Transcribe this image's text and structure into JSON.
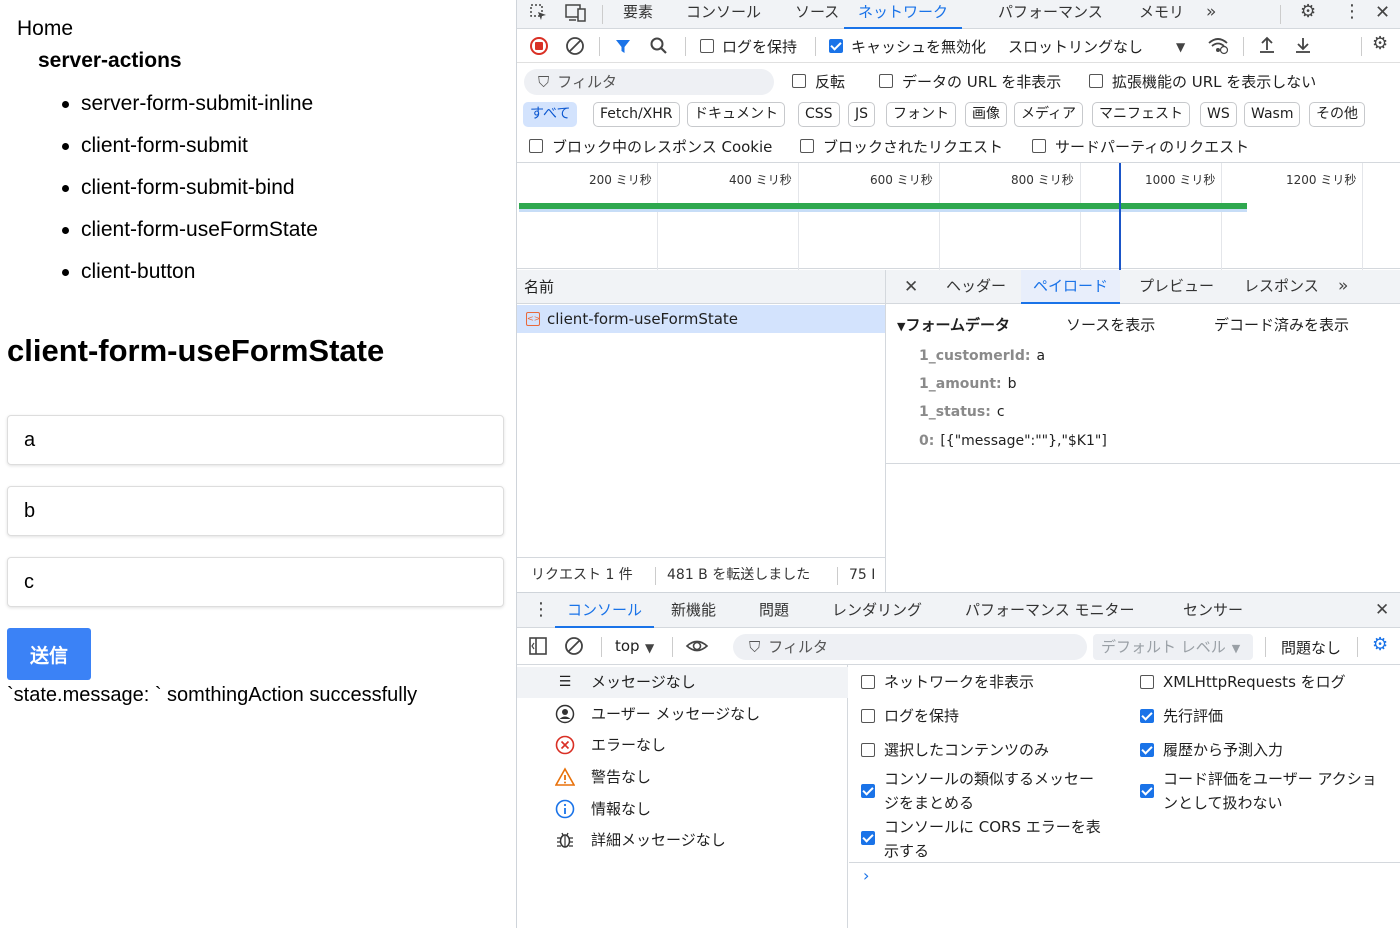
{
  "page": {
    "home_link": "Home",
    "section_title": "server-actions",
    "nav_items": [
      "server-form-submit-inline",
      "client-form-submit",
      "client-form-submit-bind",
      "client-form-useFormState",
      "client-button"
    ],
    "form_title": "client-form-useFormState",
    "fields": [
      {
        "value": "a"
      },
      {
        "value": "b"
      },
      {
        "value": "c"
      }
    ],
    "submit_label": "送信",
    "state_message": "`state.message: ` somthingAction successfully"
  },
  "devtools": {
    "main_tabs": [
      "要素",
      "コンソール",
      "ソース",
      "ネットワーク",
      "パフォーマンス",
      "メモリ"
    ],
    "active_main_tab": "ネットワーク",
    "network_toolbar": {
      "preserve_log_label": "ログを保持",
      "preserve_log_checked": false,
      "disable_cache_label": "キャッシュを無効化",
      "disable_cache_checked": true,
      "throttling_label": "スロットリングなし"
    },
    "filter_bar": {
      "placeholder": "フィルタ",
      "invert_label": "反転",
      "hide_data_url_label": "データの URL を非表示",
      "hide_ext_url_label": "拡張機能の URL を表示しない"
    },
    "type_chips": [
      "すべて",
      "Fetch/XHR",
      "ドキュメント",
      "CSS",
      "JS",
      "フォント",
      "画像",
      "メディア",
      "マニフェスト",
      "WS",
      "Wasm",
      "その他"
    ],
    "active_chip": "すべて",
    "blocked_options": {
      "blocked_cookies_label": "ブロック中のレスポンス Cookie",
      "blocked_requests_label": "ブロックされたリクエスト",
      "third_party_label": "サードパーティのリクエスト"
    },
    "timeline_ticks": [
      "200 ミリ秒",
      "400 ミリ秒",
      "600 ミリ秒",
      "800 ミリ秒",
      "1000 ミリ秒",
      "1200 ミリ秒"
    ],
    "request_list": {
      "name_header": "名前",
      "requests": [
        {
          "name": "client-form-useFormState"
        }
      ],
      "status_requests": "リクエスト 1 件",
      "status_transferred": "481 B を転送しました",
      "status_resources": "75 I"
    },
    "detail_tabs": [
      "ヘッダー",
      "ペイロード",
      "プレビュー",
      "レスポンス"
    ],
    "active_detail_tab": "ペイロード",
    "payload": {
      "section_label": "フォームデータ",
      "view_source_label": "ソースを表示",
      "view_decoded_label": "デコード済みを表示",
      "entries": [
        {
          "key": "1_customerId:",
          "value": "a"
        },
        {
          "key": "1_amount:",
          "value": "b"
        },
        {
          "key": "1_status:",
          "value": "c"
        },
        {
          "key": "0:",
          "value": "[{\"message\":\"\"},\"$K1\"]"
        }
      ]
    },
    "drawer_tabs": [
      "コンソール",
      "新機能",
      "問題",
      "レンダリング",
      "パフォーマンス モニター",
      "センサー"
    ],
    "active_drawer_tab": "コンソール",
    "console_toolbar": {
      "context": "top",
      "filter_placeholder": "フィルタ",
      "level": "デフォルト レベル",
      "issues": "問題なし"
    },
    "console_sidebar": [
      {
        "label": "メッセージなし",
        "icon": "list-icon"
      },
      {
        "label": "ユーザー メッセージなし",
        "icon": "user-icon"
      },
      {
        "label": "エラーなし",
        "icon": "error-icon"
      },
      {
        "label": "警告なし",
        "icon": "warning-icon"
      },
      {
        "label": "情報なし",
        "icon": "info-icon"
      },
      {
        "label": "詳細メッセージなし",
        "icon": "bug-icon"
      }
    ],
    "console_settings": {
      "hide_network": {
        "label": "ネットワークを非表示",
        "checked": false
      },
      "preserve_log": {
        "label": "ログを保持",
        "checked": false
      },
      "selected_context": {
        "label": "選択したコンテンツのみ",
        "checked": false
      },
      "group_similar_1": "コンソールの類似するメッセー",
      "group_similar_2": "ジをまとめる",
      "group_similar_checked": true,
      "cors_errors_1": "コンソールに CORS エラーを表",
      "cors_errors_2": "示する",
      "cors_errors_checked": true,
      "log_xhr": {
        "label": "XMLHttpRequests をログ",
        "checked": false
      },
      "eager_eval": {
        "label": "先行評価",
        "checked": true
      },
      "autocomplete_history": {
        "label": "履歴から予測入力",
        "checked": true
      },
      "treat_eval_1": "コード評価をユーザー アクショ",
      "treat_eval_2": "ンとして扱わない",
      "treat_eval_checked": true
    },
    "colors": {
      "accent": "#1a73e8",
      "submit_button": "#3b82f6",
      "timeline_bar": "#2fa84f",
      "error": "#d93025",
      "warning": "#e8710a"
    }
  }
}
